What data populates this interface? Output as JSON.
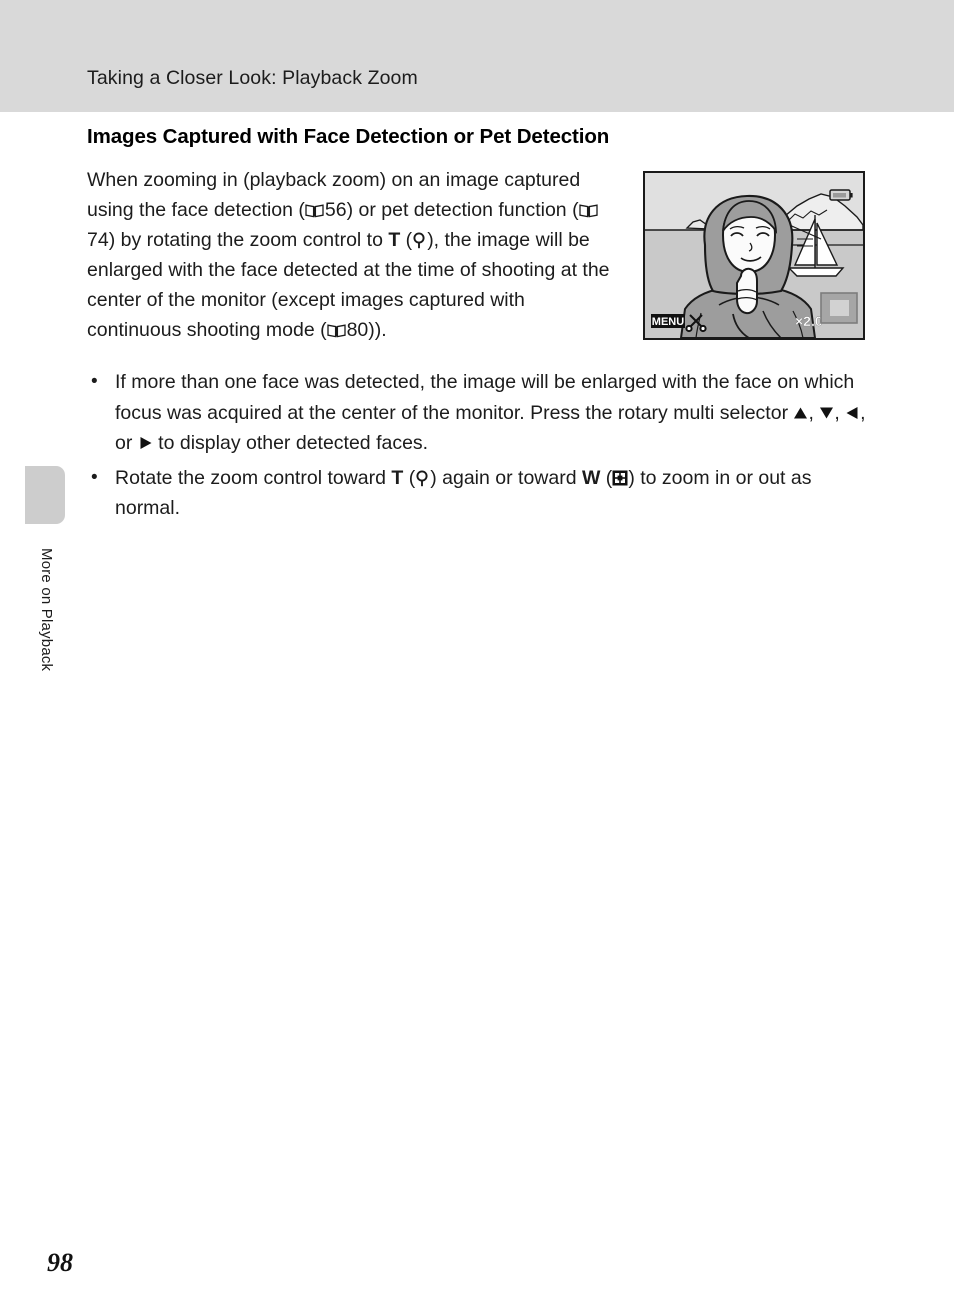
{
  "header": {
    "running_title": "Taking a Closer Look: Playback Zoom"
  },
  "side_tab": {
    "label": "More on Playback"
  },
  "page": {
    "number": "98"
  },
  "content": {
    "section_heading": "Images Captured with Face Detection or Pet Detection",
    "intro_paragraph": {
      "part1": "When zooming in (playback zoom) on an image captured using the face detection (",
      "ref1": "56",
      "part2": ") or pet detection function (",
      "ref2": "74",
      "part3": ") by rotating the zoom control to ",
      "tele_letter": "T",
      "part4": " (",
      "part5": "), the image will be enlarged with the face detected at the time of shooting at the center of the monitor (except images captured with continuous shooting mode (",
      "ref3": "80",
      "part6": "))."
    },
    "bullets": [
      {
        "marker": "•",
        "part1": "If more than one face was detected, the image will be enlarged with the face on which focus was acquired at the center of the monitor. Press the rotary multi selector ",
        "sep1": ", ",
        "sep2": ", ",
        "sep3": ", or ",
        "part2": " to display other detected faces."
      },
      {
        "marker": "•",
        "part1": "Rotate the zoom control toward ",
        "tele_letter": "T",
        "part2": " (",
        "part3": ") again or toward ",
        "wide_letter": "W",
        "part4": " (",
        "part5": ") to zoom in or out as normal."
      }
    ]
  },
  "illustration": {
    "menu_label": "MENU",
    "zoom_ratio": "×2.0",
    "icons": {
      "battery": "battery-icon",
      "scissors": "scissors-icon",
      "navigation_box": "navigation-thumbnail-box"
    },
    "scene": {
      "subject": "woman-portrait",
      "background": "seascape-with-sailboat-and-mountains"
    }
  },
  "colors": {
    "header_band": "#d9d9d9",
    "side_tab": "#cdcdcd",
    "text": "#1c1c1c",
    "illustration_frame": "#1a1a1a"
  }
}
